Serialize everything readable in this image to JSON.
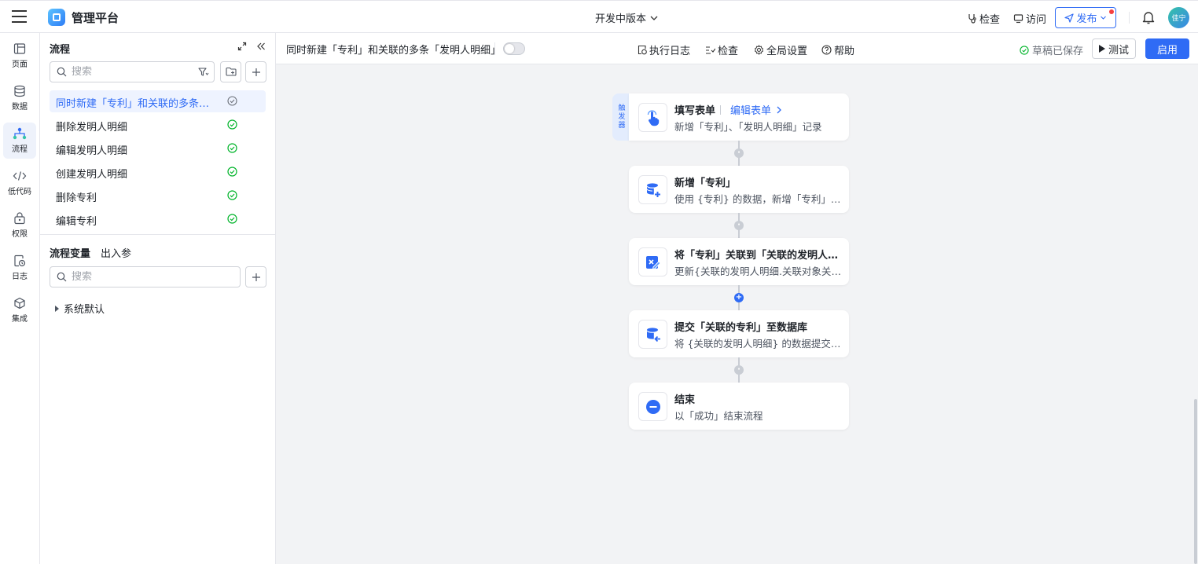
{
  "app": {
    "title": "管理平台",
    "version": "开发中版本"
  },
  "topbar": {
    "check": "检查",
    "visit": "访问",
    "publish": "发布",
    "avatar": "佳宁"
  },
  "rail": [
    {
      "label": "页面",
      "icon": "page-icon"
    },
    {
      "label": "数据",
      "icon": "database-icon"
    },
    {
      "label": "流程",
      "icon": "flow-icon"
    },
    {
      "label": "低代码",
      "icon": "code-icon"
    },
    {
      "label": "权限",
      "icon": "lock-icon"
    },
    {
      "label": "日志",
      "icon": "log-icon"
    },
    {
      "label": "集成",
      "icon": "integration-icon"
    }
  ],
  "panel": {
    "title": "流程",
    "search_placeholder": "搜索",
    "flows": [
      {
        "name": "同时新建「专利」和关联的多条「发明人明细」",
        "status": "draft"
      },
      {
        "name": "删除发明人明细",
        "status": "enabled"
      },
      {
        "name": "编辑发明人明细",
        "status": "enabled"
      },
      {
        "name": "创建发明人明细",
        "status": "enabled"
      },
      {
        "name": "删除专利",
        "status": "enabled"
      },
      {
        "name": "编辑专利",
        "status": "enabled"
      }
    ],
    "var_tab": "流程变量",
    "param_tab": "出入参",
    "var_search_placeholder": "搜索",
    "sys_default": "系统默认"
  },
  "toolbar": {
    "flow_title": "同时新建「专利」和关联的多条「发明人明细」",
    "exec_log": "执行日志",
    "check": "检查",
    "global_settings": "全局设置",
    "help": "帮助",
    "saved": "草稿已保存",
    "test": "测试",
    "enable": "启用"
  },
  "flow": {
    "trigger_tag": [
      "触",
      "发",
      "器"
    ],
    "edit_form": "编辑表单",
    "nodes": [
      {
        "title": "填写表单",
        "sub": "新增「专利」、「发明人明细」记录",
        "icon": "hand-pointer-icon"
      },
      {
        "title": "新增「专利」",
        "sub": "使用 {专利} 的数据，新增「专利」记录",
        "icon": "database-add-icon"
      },
      {
        "title": "将「专利」关联到「关联的发明人明细」",
        "sub": "更新{关联的发明人明细.关联对象关联字段}",
        "icon": "edit-link-icon"
      },
      {
        "title": "提交「关联的专利」至数据库",
        "sub": "将 {关联的发明人明细} 的数据提交入库",
        "icon": "database-submit-icon"
      },
      {
        "title": "结束",
        "sub": "以「成功」结束流程",
        "icon": "end-icon"
      }
    ]
  },
  "colors": {
    "primary": "#2f6bf5",
    "success": "#00b42a",
    "canvas": "#f2f3f5"
  }
}
